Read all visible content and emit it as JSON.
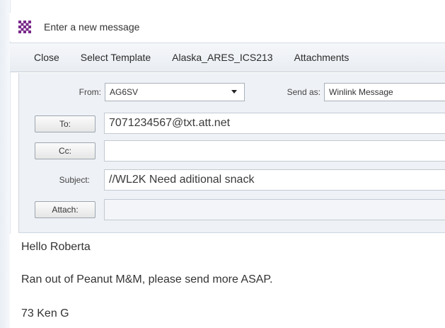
{
  "window": {
    "title": "Enter a new message",
    "icon": "winlink-grid-icon",
    "accent_color": "#7a2a8a"
  },
  "menu": {
    "items": [
      "Close",
      "Select Template",
      "Alaska_ARES_ICS213",
      "Attachments"
    ]
  },
  "header": {
    "from_label": "From:",
    "from_value": "AG6SV",
    "send_as_label": "Send as:",
    "send_as_value": "Winlink Message",
    "to_button": "To:",
    "to_value": "7071234567@txt.att.net",
    "cc_button": "Cc:",
    "cc_value": "",
    "subject_label": "Subject:",
    "subject_value": "//WL2K Need aditional snack",
    "attach_button": "Attach:",
    "attach_value": ""
  },
  "body": {
    "lines": [
      "Hello Roberta",
      "Ran out of Peanut M&M, please send more ASAP.",
      "73 Ken G"
    ]
  }
}
